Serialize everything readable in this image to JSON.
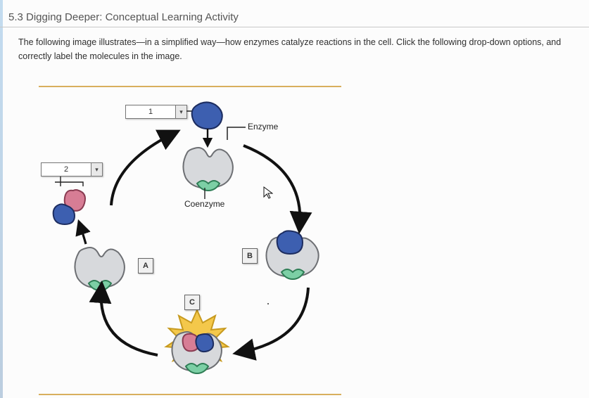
{
  "section_title": "5.3 Digging Deeper: Conceptual Learning Activity",
  "instructions": "The following image illustrates—in a simplified way—how enzymes catalyze reactions in the cell. Click the following drop-down options, and correctly label the molecules in the image.",
  "dropdowns": {
    "dd1": {
      "value": "1"
    },
    "dd2": {
      "value": "2"
    }
  },
  "markers": {
    "A": "A",
    "B": "B",
    "C": "C"
  },
  "labels": {
    "enzyme": "Enzyme",
    "coenzyme": "Coenzyme"
  },
  "chart_data": {
    "type": "diagram",
    "title": "Enzyme catalytic cycle (simplified)",
    "nodes": [
      {
        "id": "substrate",
        "label_source": "dropdown-1",
        "annotation": ""
      },
      {
        "id": "products",
        "label_source": "dropdown-2",
        "annotation": ""
      },
      {
        "id": "enzyme_free",
        "annotation": "Enzyme"
      },
      {
        "id": "coenzyme",
        "annotation": "Coenzyme"
      },
      {
        "id": "stage_A",
        "marker": "A",
        "desc": "free enzyme + coenzyme"
      },
      {
        "id": "stage_B",
        "marker": "B",
        "desc": "enzyme-substrate complex"
      },
      {
        "id": "stage_C",
        "marker": "C",
        "desc": "catalysis / transition (starburst)"
      }
    ],
    "cycle_edges": [
      [
        "stage_A",
        "enzyme_free"
      ],
      [
        "enzyme_free",
        "stage_B"
      ],
      [
        "stage_B",
        "stage_C"
      ],
      [
        "stage_C",
        "stage_A"
      ]
    ],
    "extra_edges": [
      {
        "from": "substrate",
        "to": "enzyme_free",
        "kind": "input"
      },
      {
        "from": "stage_A",
        "to": "products",
        "kind": "output"
      }
    ]
  }
}
